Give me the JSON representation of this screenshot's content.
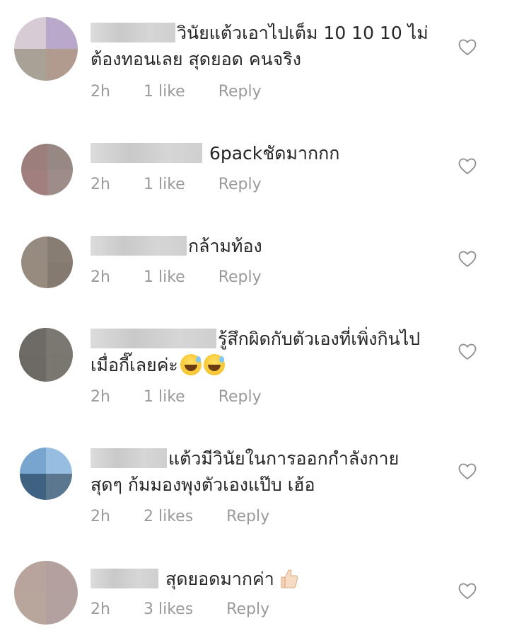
{
  "comments": [
    {
      "text": "วินัยแต้วเอาไปเต็ม 10 10 10 ไม่ต้องทอนเลย สุดยอด คนจริง",
      "time": "2h",
      "likes": "1 like",
      "reply": "Reply",
      "avatar_colors": [
        "#d7ccd6",
        "#b9a8c9",
        "#a8a296",
        "#b19a8e"
      ]
    },
    {
      "text": "6packชัดมากกก",
      "time": "2h",
      "likes": "1 like",
      "reply": "Reply",
      "avatar_colors": [
        "#9c7f7d",
        "#988883",
        "#a07f7e",
        "#9e8c88"
      ]
    },
    {
      "text": "กล้ามท้อง",
      "time": "2h",
      "likes": "1 like",
      "reply": "Reply",
      "avatar_colors": [
        "#968b80",
        "#877d73",
        "#978b7f",
        "#857a6f"
      ]
    },
    {
      "text": "รู้สึกผิดกับตัวเองที่เพิ่งกินไปเมื่อกี๊เลยค่ะ",
      "emoji_count": 2,
      "emoji_icon": "grinning-sweat-emoji",
      "time": "2h",
      "likes": "1 like",
      "reply": "Reply",
      "avatar_colors": [
        "#6e6b66",
        "#7b7872",
        "#6d6a65",
        "#7a7771"
      ]
    },
    {
      "text": "แต้วมีวินัยในการออกกำลังกาย สุดๆ ก้มมองพุงตัวเองแป๊บ เฮ้อ",
      "time": "2h",
      "likes": "2 likes",
      "reply": "Reply",
      "avatar_colors": [
        "#77a5cf",
        "#97bde0",
        "#3f6282",
        "#5b7790"
      ]
    },
    {
      "text": "สุดยอดมากค่า",
      "emoji_icon": "thumbs-up-emoji",
      "time": "2h",
      "likes": "3 likes",
      "reply": "Reply",
      "avatar_colors": [
        "#b8a49d",
        "#b4a09e",
        "#b8a59c",
        "#b3a19f"
      ]
    }
  ],
  "icons": {
    "heart": "heart-outline-icon"
  },
  "colors": {
    "text": "#262626",
    "meta": "#9a9a9a",
    "heart_stroke": "#8e8e8e"
  }
}
